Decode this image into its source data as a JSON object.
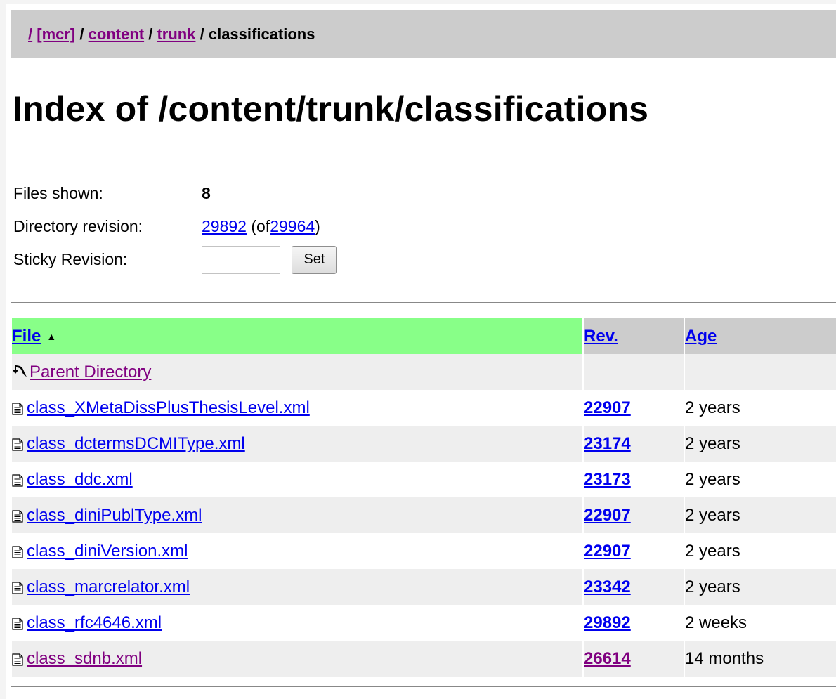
{
  "breadcrumb": {
    "root": "/",
    "repo": "[mcr]",
    "content": "content",
    "trunk": "trunk",
    "current": "classifications",
    "sep": "/"
  },
  "title": "Index of /content/trunk/classifications",
  "info": {
    "files_shown_label": "Files shown:",
    "files_shown_value": "8",
    "dir_revision_label": "Directory revision:",
    "dir_revision_value": "29892",
    "dir_revision_of_prefix": "(of",
    "dir_revision_head": "29964",
    "dir_revision_of_suffix": ")",
    "sticky_label": "Sticky Revision:",
    "sticky_value": "",
    "set_button": "Set"
  },
  "table": {
    "headers": {
      "file": "File",
      "rev": "Rev.",
      "age": "Age"
    },
    "sort_indicator": "▲",
    "parent": {
      "label": "Parent Directory"
    },
    "rows": [
      {
        "name": "class_XMetaDissPlusThesisLevel.xml",
        "rev": "22907",
        "age": "2 years"
      },
      {
        "name": "class_dctermsDCMIType.xml",
        "rev": "23174",
        "age": "2 years"
      },
      {
        "name": "class_ddc.xml",
        "rev": "23173",
        "age": "2 years"
      },
      {
        "name": "class_diniPublType.xml",
        "rev": "22907",
        "age": "2 years"
      },
      {
        "name": "class_diniVersion.xml",
        "rev": "22907",
        "age": "2 years"
      },
      {
        "name": "class_marcrelator.xml",
        "rev": "23342",
        "age": "2 years"
      },
      {
        "name": "class_rfc4646.xml",
        "rev": "29892",
        "age": "2 weeks"
      },
      {
        "name": "class_sdnb.xml",
        "rev": "26614",
        "age": "14 months"
      }
    ]
  },
  "icons": {
    "parent": "back-arrow-icon",
    "file": "text-file-icon"
  },
  "colors": {
    "link": "#0000ee",
    "visited": "#800080",
    "sorted_header": "#88ff88",
    "header": "#cccccc",
    "alt_row": "#eeeeee"
  }
}
